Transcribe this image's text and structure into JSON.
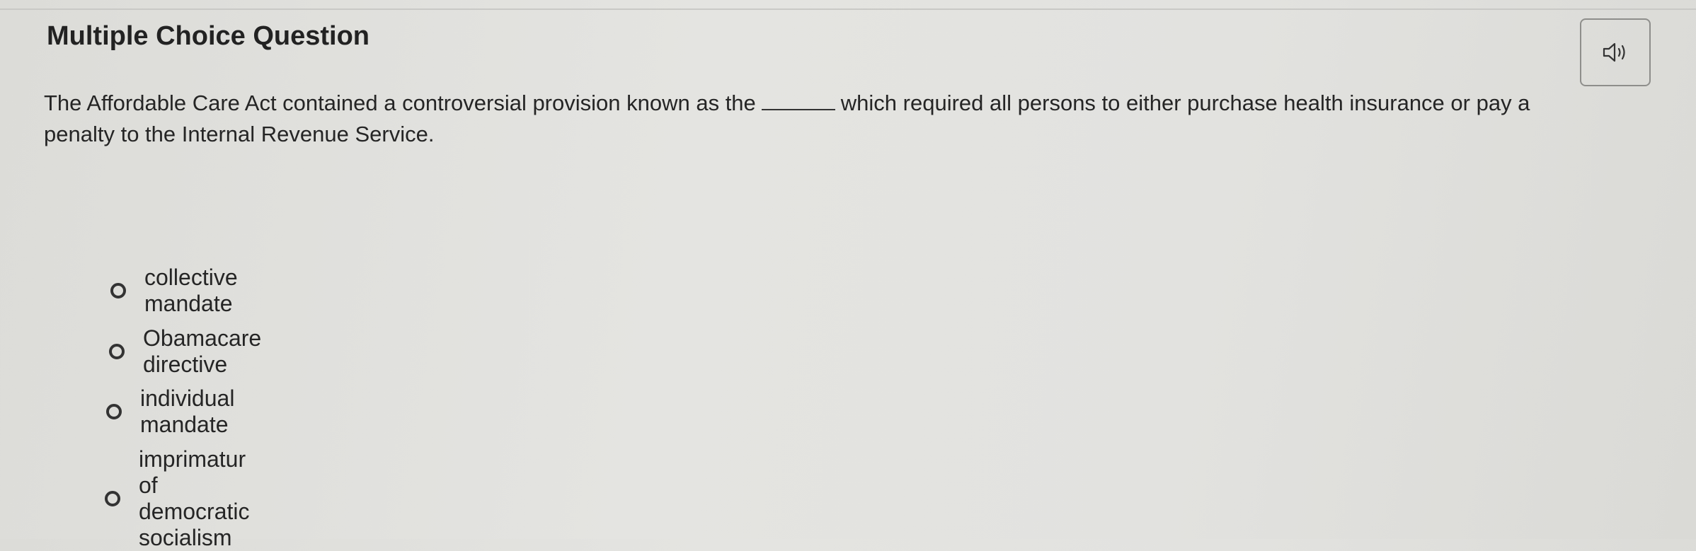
{
  "question": {
    "header": "Multiple Choice Question",
    "text_before_blank": "The Affordable Care Act contained a controversial provision known as the",
    "text_after_blank": "which required all persons to either purchase health insurance or pay a penalty to the Internal Revenue Service."
  },
  "audio_button": {
    "icon": "speaker-icon"
  },
  "options": [
    {
      "label": "collective mandate",
      "selected": false
    },
    {
      "label": "Obamacare directive",
      "selected": false
    },
    {
      "label": "individual mandate",
      "selected": false
    },
    {
      "label": "imprimatur of democratic socialism",
      "selected": false
    }
  ]
}
